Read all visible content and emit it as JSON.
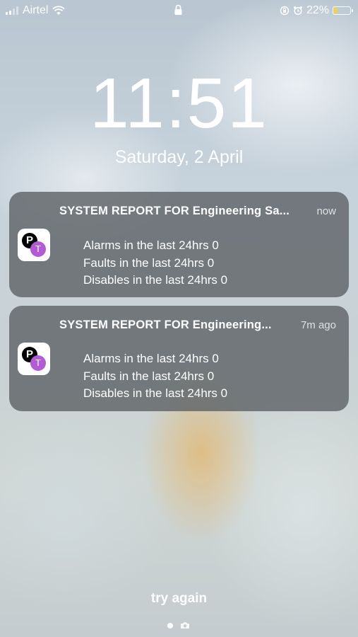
{
  "status_bar": {
    "carrier": "Airtel",
    "battery_percent": "22%",
    "battery_level": 0.22,
    "icons": [
      "signal-icon",
      "wifi-icon",
      "lock-icon",
      "orientation-lock-icon",
      "alarm-icon",
      "battery-icon"
    ]
  },
  "lock_screen": {
    "time": "11:51",
    "date": "Saturday, 2 April",
    "try_again_label": "try again"
  },
  "notifications": [
    {
      "title": "SYSTEM REPORT FOR Engineering Sa...",
      "time": "now",
      "app_icon_letters": [
        "P",
        "T"
      ],
      "lines": [
        "Alarms in the last 24hrs 0",
        "Faults in the last 24hrs 0",
        "Disables in the last 24hrs 0"
      ]
    },
    {
      "title": "SYSTEM REPORT FOR Engineering...",
      "time": "7m ago",
      "app_icon_letters": [
        "P",
        "T"
      ],
      "lines": [
        "Alarms in the last 24hrs 0",
        "Faults in the last 24hrs 0",
        "Disables in the last 24hrs 0"
      ]
    }
  ],
  "colors": {
    "notification_bg": "#5f6468",
    "battery_fill": "#f5d33f",
    "app_icon_purple": "#b25bd6"
  }
}
